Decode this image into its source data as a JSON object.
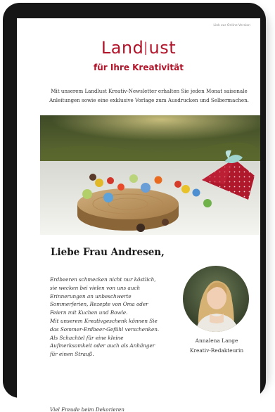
{
  "header": {
    "online_link": "Link zur Online-Version",
    "logo_text": "Landlust",
    "tagline": "für Ihre Kreativität"
  },
  "intro": "Mit unserem Landlust Kreativ-Newsletter erhalten Sie jeden Monat saisonale Anleitungen sowie eine exklusive Vorlage zum Ausdrucken und Selbermachen.",
  "greeting": "Liebe Frau Andresen,",
  "body_lines": [
    "Erdbeeren schmecken nicht nur köstlich,",
    "sie wecken bei vielen von uns auch",
    "Erinnerungen an unbeschwerte",
    "Sommerferien, Rezepte von Oma oder",
    "Feiern mit Kuchen und Bowle.",
    "Mit unserem Kreativgeschenk können Sie",
    "das Sommer-Erdbeer-Gefühl verschenken.",
    "Als Schachtel für eine kleine",
    "Aufmerksamkeit oder auch als Anhänger",
    "für einen Strauß."
  ],
  "author": {
    "name": "Annalena Lange",
    "role": "Kreativ-Redakteurin"
  },
  "closing": "Viel Freude beim Dekorieren",
  "colors": {
    "brand": "#b2142a",
    "device_frame": "#161616"
  }
}
